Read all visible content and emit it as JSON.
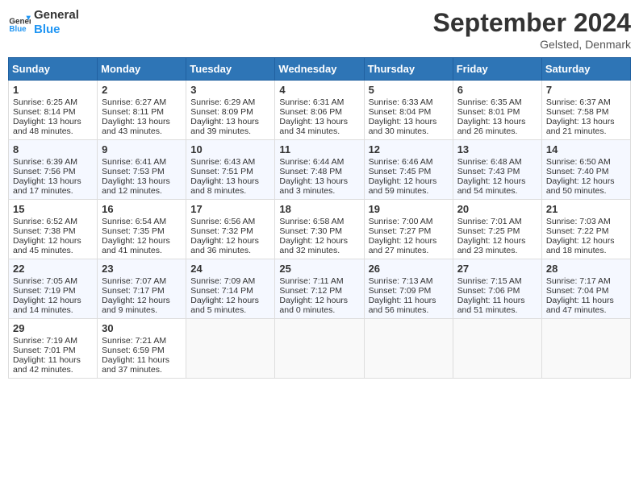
{
  "header": {
    "logo_line1": "General",
    "logo_line2": "Blue",
    "month": "September 2024",
    "location": "Gelsted, Denmark"
  },
  "weekdays": [
    "Sunday",
    "Monday",
    "Tuesday",
    "Wednesday",
    "Thursday",
    "Friday",
    "Saturday"
  ],
  "weeks": [
    [
      {
        "day": "1",
        "lines": [
          "Sunrise: 6:25 AM",
          "Sunset: 8:14 PM",
          "Daylight: 13 hours",
          "and 48 minutes."
        ]
      },
      {
        "day": "2",
        "lines": [
          "Sunrise: 6:27 AM",
          "Sunset: 8:11 PM",
          "Daylight: 13 hours",
          "and 43 minutes."
        ]
      },
      {
        "day": "3",
        "lines": [
          "Sunrise: 6:29 AM",
          "Sunset: 8:09 PM",
          "Daylight: 13 hours",
          "and 39 minutes."
        ]
      },
      {
        "day": "4",
        "lines": [
          "Sunrise: 6:31 AM",
          "Sunset: 8:06 PM",
          "Daylight: 13 hours",
          "and 34 minutes."
        ]
      },
      {
        "day": "5",
        "lines": [
          "Sunrise: 6:33 AM",
          "Sunset: 8:04 PM",
          "Daylight: 13 hours",
          "and 30 minutes."
        ]
      },
      {
        "day": "6",
        "lines": [
          "Sunrise: 6:35 AM",
          "Sunset: 8:01 PM",
          "Daylight: 13 hours",
          "and 26 minutes."
        ]
      },
      {
        "day": "7",
        "lines": [
          "Sunrise: 6:37 AM",
          "Sunset: 7:58 PM",
          "Daylight: 13 hours",
          "and 21 minutes."
        ]
      }
    ],
    [
      {
        "day": "8",
        "lines": [
          "Sunrise: 6:39 AM",
          "Sunset: 7:56 PM",
          "Daylight: 13 hours",
          "and 17 minutes."
        ]
      },
      {
        "day": "9",
        "lines": [
          "Sunrise: 6:41 AM",
          "Sunset: 7:53 PM",
          "Daylight: 13 hours",
          "and 12 minutes."
        ]
      },
      {
        "day": "10",
        "lines": [
          "Sunrise: 6:43 AM",
          "Sunset: 7:51 PM",
          "Daylight: 13 hours",
          "and 8 minutes."
        ]
      },
      {
        "day": "11",
        "lines": [
          "Sunrise: 6:44 AM",
          "Sunset: 7:48 PM",
          "Daylight: 13 hours",
          "and 3 minutes."
        ]
      },
      {
        "day": "12",
        "lines": [
          "Sunrise: 6:46 AM",
          "Sunset: 7:45 PM",
          "Daylight: 12 hours",
          "and 59 minutes."
        ]
      },
      {
        "day": "13",
        "lines": [
          "Sunrise: 6:48 AM",
          "Sunset: 7:43 PM",
          "Daylight: 12 hours",
          "and 54 minutes."
        ]
      },
      {
        "day": "14",
        "lines": [
          "Sunrise: 6:50 AM",
          "Sunset: 7:40 PM",
          "Daylight: 12 hours",
          "and 50 minutes."
        ]
      }
    ],
    [
      {
        "day": "15",
        "lines": [
          "Sunrise: 6:52 AM",
          "Sunset: 7:38 PM",
          "Daylight: 12 hours",
          "and 45 minutes."
        ]
      },
      {
        "day": "16",
        "lines": [
          "Sunrise: 6:54 AM",
          "Sunset: 7:35 PM",
          "Daylight: 12 hours",
          "and 41 minutes."
        ]
      },
      {
        "day": "17",
        "lines": [
          "Sunrise: 6:56 AM",
          "Sunset: 7:32 PM",
          "Daylight: 12 hours",
          "and 36 minutes."
        ]
      },
      {
        "day": "18",
        "lines": [
          "Sunrise: 6:58 AM",
          "Sunset: 7:30 PM",
          "Daylight: 12 hours",
          "and 32 minutes."
        ]
      },
      {
        "day": "19",
        "lines": [
          "Sunrise: 7:00 AM",
          "Sunset: 7:27 PM",
          "Daylight: 12 hours",
          "and 27 minutes."
        ]
      },
      {
        "day": "20",
        "lines": [
          "Sunrise: 7:01 AM",
          "Sunset: 7:25 PM",
          "Daylight: 12 hours",
          "and 23 minutes."
        ]
      },
      {
        "day": "21",
        "lines": [
          "Sunrise: 7:03 AM",
          "Sunset: 7:22 PM",
          "Daylight: 12 hours",
          "and 18 minutes."
        ]
      }
    ],
    [
      {
        "day": "22",
        "lines": [
          "Sunrise: 7:05 AM",
          "Sunset: 7:19 PM",
          "Daylight: 12 hours",
          "and 14 minutes."
        ]
      },
      {
        "day": "23",
        "lines": [
          "Sunrise: 7:07 AM",
          "Sunset: 7:17 PM",
          "Daylight: 12 hours",
          "and 9 minutes."
        ]
      },
      {
        "day": "24",
        "lines": [
          "Sunrise: 7:09 AM",
          "Sunset: 7:14 PM",
          "Daylight: 12 hours",
          "and 5 minutes."
        ]
      },
      {
        "day": "25",
        "lines": [
          "Sunrise: 7:11 AM",
          "Sunset: 7:12 PM",
          "Daylight: 12 hours",
          "and 0 minutes."
        ]
      },
      {
        "day": "26",
        "lines": [
          "Sunrise: 7:13 AM",
          "Sunset: 7:09 PM",
          "Daylight: 11 hours",
          "and 56 minutes."
        ]
      },
      {
        "day": "27",
        "lines": [
          "Sunrise: 7:15 AM",
          "Sunset: 7:06 PM",
          "Daylight: 11 hours",
          "and 51 minutes."
        ]
      },
      {
        "day": "28",
        "lines": [
          "Sunrise: 7:17 AM",
          "Sunset: 7:04 PM",
          "Daylight: 11 hours",
          "and 47 minutes."
        ]
      }
    ],
    [
      {
        "day": "29",
        "lines": [
          "Sunrise: 7:19 AM",
          "Sunset: 7:01 PM",
          "Daylight: 11 hours",
          "and 42 minutes."
        ]
      },
      {
        "day": "30",
        "lines": [
          "Sunrise: 7:21 AM",
          "Sunset: 6:59 PM",
          "Daylight: 11 hours",
          "and 37 minutes."
        ]
      },
      {
        "day": "",
        "lines": []
      },
      {
        "day": "",
        "lines": []
      },
      {
        "day": "",
        "lines": []
      },
      {
        "day": "",
        "lines": []
      },
      {
        "day": "",
        "lines": []
      }
    ]
  ]
}
